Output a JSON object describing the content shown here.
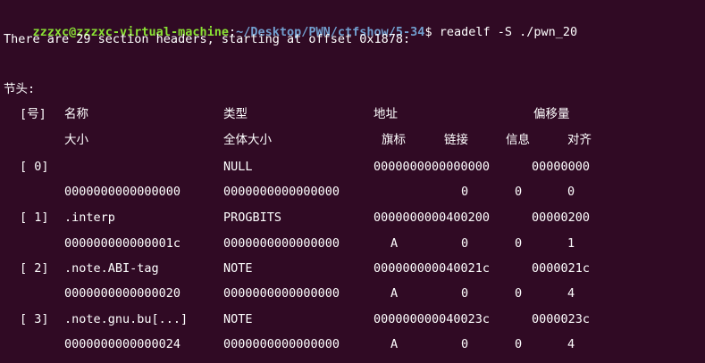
{
  "terminal": {
    "prompt_user": "zzzxc@zzzxc-virtual-machine",
    "prompt_sep": ":",
    "prompt_path": "~/Desktop/PWN/ctfshow/5-34",
    "prompt_dollar": "$ ",
    "command": "readelf -S ./pwn_20",
    "summary": "There are 29 section headers, starting at offset 0x1878:",
    "section_heading": "节头:",
    "header1": {
      "nr": "[号]",
      "name": "名称",
      "type": "类型",
      "addr": "地址",
      "offset": "偏移量"
    },
    "header2": {
      "size": "大小",
      "entsize": "全体大小",
      "flags": "旗标",
      "link": "链接",
      "info": "信息",
      "align": "对齐"
    },
    "sections": [
      {
        "nr": "[ 0]",
        "name": "",
        "type": "NULL",
        "addr": "0000000000000000",
        "offset": "00000000",
        "size": "0000000000000000",
        "entsize": "0000000000000000",
        "flags": "",
        "link": "0",
        "info": "0",
        "align": "0"
      },
      {
        "nr": "[ 1]",
        "name": ".interp",
        "type": "PROGBITS",
        "addr": "0000000000400200",
        "offset": "00000200",
        "size": "000000000000001c",
        "entsize": "0000000000000000",
        "flags": "A",
        "link": "0",
        "info": "0",
        "align": "1"
      },
      {
        "nr": "[ 2]",
        "name": ".note.ABI-tag",
        "type": "NOTE",
        "addr": "000000000040021c",
        "offset": "0000021c",
        "size": "0000000000000020",
        "entsize": "0000000000000000",
        "flags": "A",
        "link": "0",
        "info": "0",
        "align": "4"
      },
      {
        "nr": "[ 3]",
        "name": ".note.gnu.bu[...]",
        "type": "NOTE",
        "addr": "000000000040023c",
        "offset": "0000023c",
        "size": "0000000000000024",
        "entsize": "0000000000000000",
        "flags": "A",
        "link": "0",
        "info": "0",
        "align": "4"
      }
    ]
  }
}
